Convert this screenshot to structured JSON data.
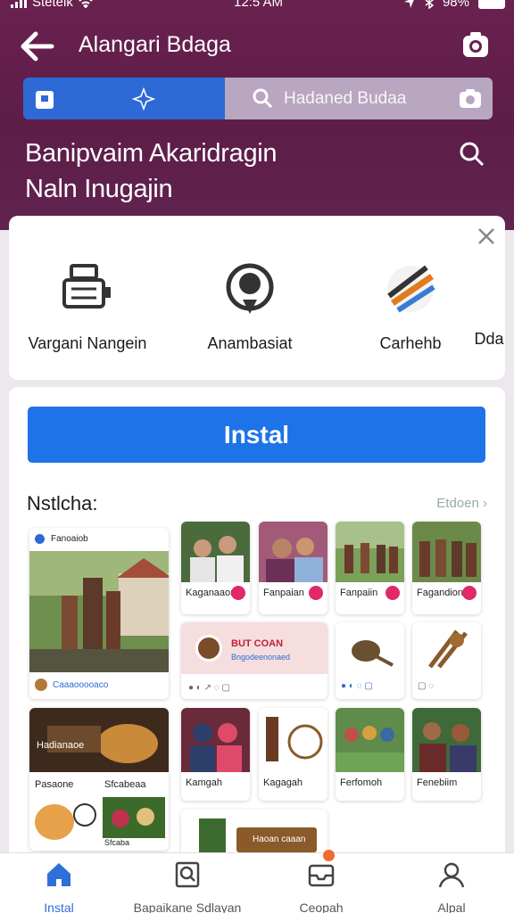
{
  "status": {
    "carrier": "Stetelk",
    "time": "12:5 AM",
    "battery": "98%"
  },
  "header": {
    "title": "Alangari Bdaga"
  },
  "searchbar": {
    "placeholder": "Hadaned Budaa"
  },
  "headline": {
    "line1": "Banipvaim Akaridragin",
    "line2": "Naln Inugajin"
  },
  "categories": [
    {
      "label": "Vargani Nangein",
      "icon": "cash-register-icon"
    },
    {
      "label": "Anambasiat",
      "icon": "person-pin-icon"
    },
    {
      "label": "Carhehb",
      "icon": "brush-palette-icon"
    },
    {
      "label": "Dda",
      "icon": ""
    }
  ],
  "install_label": "Instal",
  "section": {
    "title": "Nstlcha:",
    "more": "Etdoen"
  },
  "tiles": {
    "big1": {
      "header": "Fanoaiob",
      "caption": "Caaaooooaco"
    },
    "t1": {
      "caption": "Kaganaaon"
    },
    "t2": {
      "caption": "Fanpaian"
    },
    "t3": {
      "caption": "Fanpaiin"
    },
    "t4": {
      "caption": "Fagandion"
    },
    "banner": {
      "line1": "BUT COAN",
      "line2": "Bngodeenonaed"
    },
    "big2": {
      "header": "Hadianaoe",
      "caption1": "Pasaone",
      "caption2": "Sfcabeaa",
      "caption3": "Sfcaba"
    },
    "t5": {
      "caption": "Kamgah"
    },
    "t6": {
      "caption": "Kagagah"
    },
    "t7": {
      "caption": "Ferfomoh"
    },
    "t8": {
      "caption": "Fenebiim"
    },
    "bottom": {
      "label": "Haoan caaan"
    }
  },
  "tabs": [
    {
      "label": "Instal",
      "icon": "home-icon",
      "active": true
    },
    {
      "label": "Bapaikane Sdlayan",
      "icon": "image-search-icon",
      "active": false
    },
    {
      "label": "Ceopah",
      "icon": "inbox-icon",
      "active": false
    },
    {
      "label": "Alpal",
      "icon": "person-icon",
      "active": false
    }
  ],
  "colors": {
    "header": "#6a2150",
    "accent": "#1e73e8",
    "badge": "#e0286b"
  }
}
